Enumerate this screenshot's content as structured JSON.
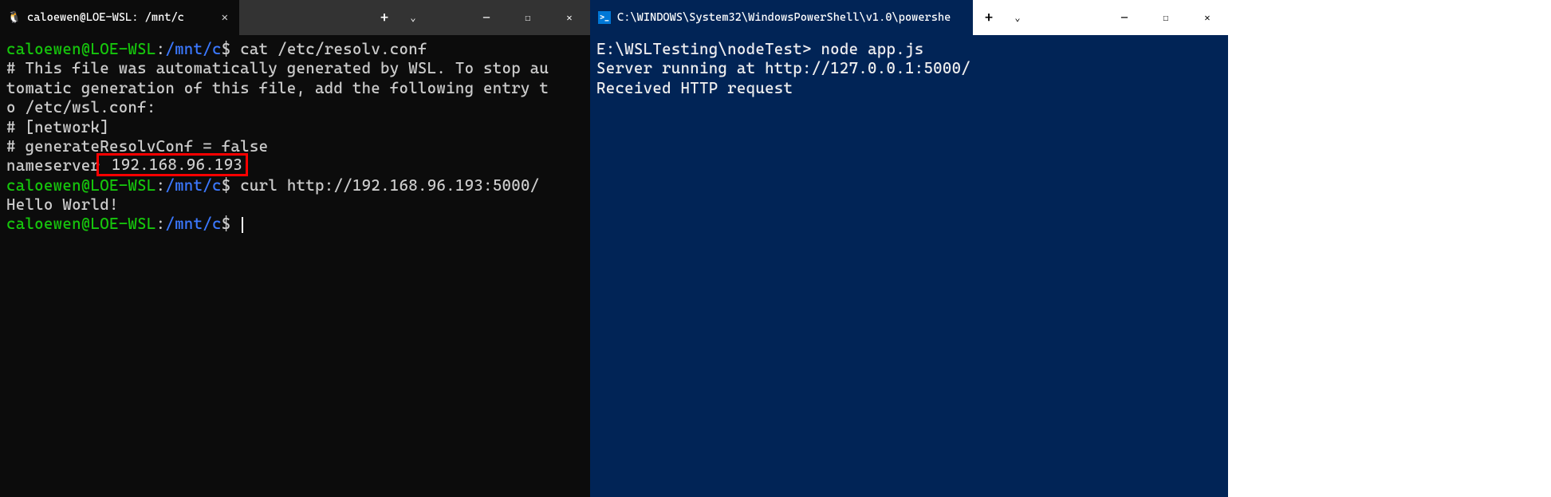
{
  "left_window": {
    "tab": {
      "icon": "🐧",
      "title": "caloewen@LOE-WSL: /mnt/c"
    },
    "controls": {
      "new_tab": "+",
      "dropdown": "⌄",
      "minimize": "─",
      "maximize": "☐",
      "close": "✕"
    },
    "terminal": {
      "prompt1": {
        "user_host": "caloewen@LOE-WSL",
        "colon": ":",
        "path": "/mnt/c",
        "dollar": "$",
        "command": "cat /etc/resolv.conf"
      },
      "output1_line1": "# This file was automatically generated by WSL. To stop au",
      "output1_line2": "tomatic generation of this file, add the following entry t",
      "output1_line3": "o /etc/wsl.conf:",
      "output1_line4": "# [network]",
      "output1_line5": "# generateResolvConf = false",
      "output1_line6_prefix": "nameserver",
      "output1_line6_ip": " 192.168.96.193",
      "prompt2": {
        "user_host": "caloewen@LOE-WSL",
        "colon": ":",
        "path": "/mnt/c",
        "dollar": "$",
        "command": "curl http://192.168.96.193:5000/"
      },
      "output2": "Hello World!",
      "prompt3": {
        "user_host": "caloewen@LOE-WSL",
        "colon": ":",
        "path": "/mnt/c",
        "dollar": "$"
      }
    }
  },
  "right_window": {
    "tab": {
      "icon": ">_",
      "title": "C:\\WINDOWS\\System32\\WindowsPowerShell\\v1.0\\powershe"
    },
    "controls": {
      "new_tab": "+",
      "dropdown": "⌄",
      "minimize": "─",
      "maximize": "☐",
      "close": "✕"
    },
    "terminal": {
      "prompt1": {
        "path": "E:\\WSLTesting\\nodeTest>",
        "command": "node app.js"
      },
      "output1": "Server running at http://127.0.0.1:5000/",
      "output2": "Received HTTP request"
    }
  }
}
